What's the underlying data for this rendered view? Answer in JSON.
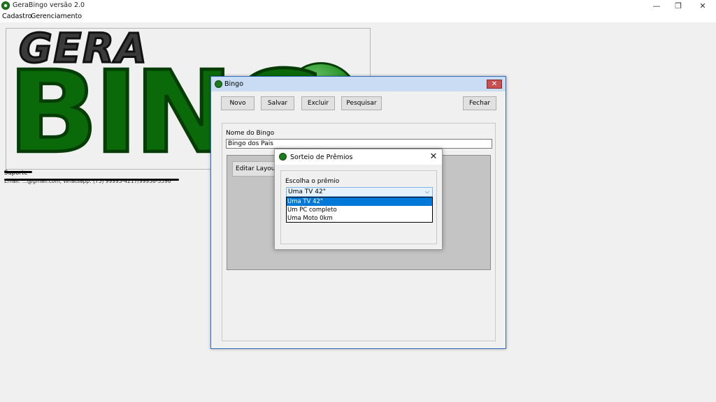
{
  "window": {
    "title": "GeraBingo  versão 2.0",
    "minimize": "—",
    "restore": "❐",
    "close": "✕"
  },
  "menu": [
    "Cadastro",
    "Gerenciamento"
  ],
  "logo": {
    "line1": "GERA",
    "line2": "BING"
  },
  "support": {
    "heading": "Suporte",
    "contact": "Email: ...@gmail.com, Whatsapp: (75) 99993-4217/99938-3596"
  },
  "bingo_dialog": {
    "title": "Bingo",
    "close": "✕",
    "buttons": {
      "novo": "Novo",
      "salvar": "Salvar",
      "excluir": "Excluir",
      "pesquisar": "Pesquisar",
      "fechar": "Fechar"
    },
    "name_label": "Nome do Bingo",
    "name_value": "Bingo dos Pais",
    "edit_layout": "Editar Layout"
  },
  "sorteio_dialog": {
    "title": "Sorteio de Prêmios",
    "close": "✕",
    "prompt": "Escolha o prêmio",
    "selected": "Uma TV 42\"",
    "arrow": "⌵",
    "options": [
      "Uma TV 42\"",
      "Um PC completo",
      "Uma Moto 0km"
    ]
  },
  "colors": {
    "brand_green": "#0a6a0a",
    "selection": "#0078d7",
    "title_active": "#c9dcf3"
  }
}
